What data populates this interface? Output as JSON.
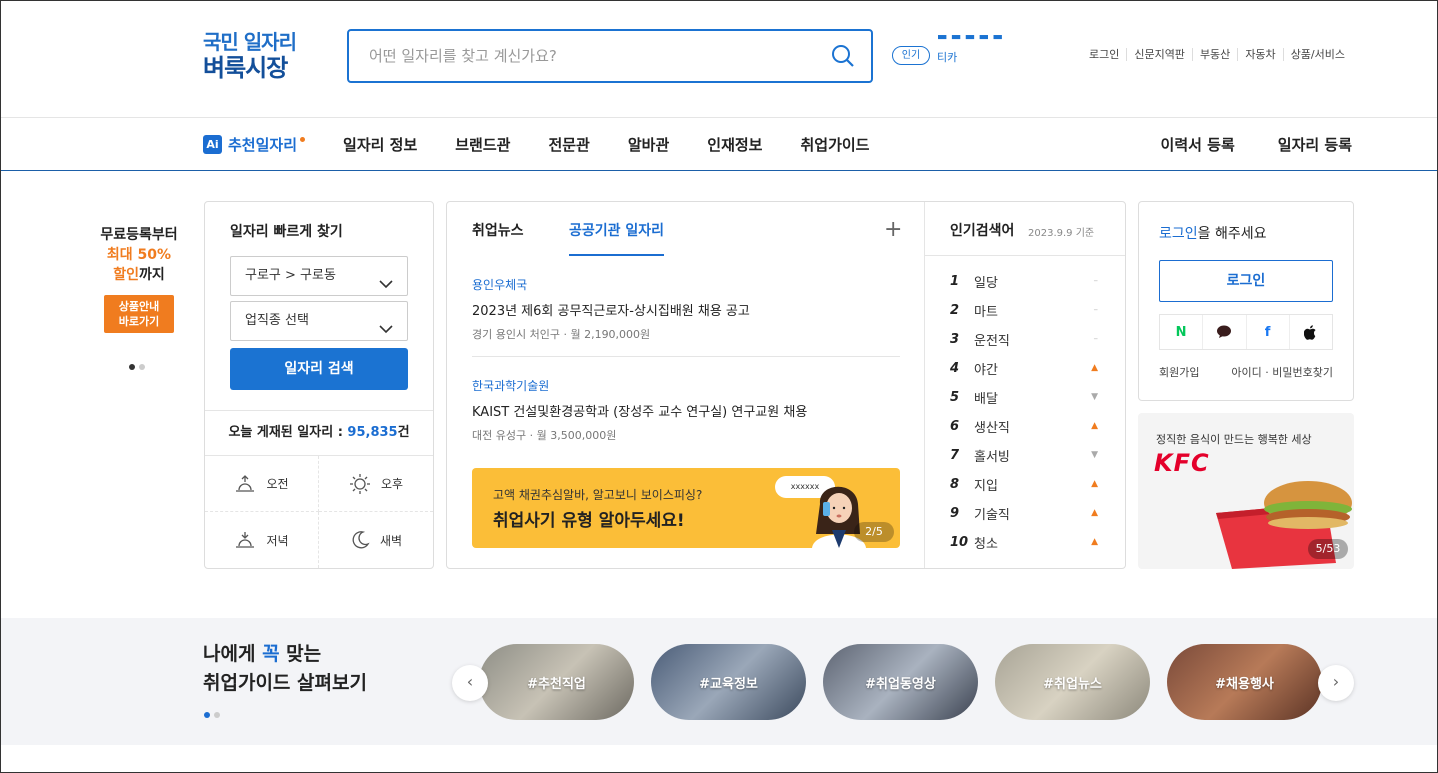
{
  "header": {
    "logo_line1": "국민 일자리",
    "logo_line2": "벼룩시장",
    "search_placeholder": "어떤 일자리를 찾고 계신가요?",
    "popular_badge": "인기",
    "popular_word": "티카",
    "util_links": [
      "로그인",
      "신문지역판",
      "부동산",
      "자동차",
      "상품/서비스"
    ]
  },
  "gnb": {
    "ai_label": "Ai",
    "ai_item": "추천일자리",
    "items": [
      "일자리 정보",
      "브랜드관",
      "전문관",
      "알바관",
      "인재정보",
      "취업가이드"
    ],
    "right": [
      "이력서 등록",
      "일자리 등록"
    ]
  },
  "promo": {
    "line1": "무료등록부터",
    "line2": "최대 50%",
    "line3a": "할인",
    "line3b": "까지",
    "btn": "상품안내\n바로가기"
  },
  "quick": {
    "title": "일자리 빠르게 찾기",
    "region": "구로구 > 구로동",
    "category": "업직종 선택",
    "search_btn": "일자리 검색",
    "today_label": "오늘 게재된 일자리 : ",
    "today_count": "95,835",
    "today_unit": "건",
    "times": [
      "오전",
      "오후",
      "저녁",
      "새벽"
    ]
  },
  "news": {
    "tabs": [
      "취업뉴스",
      "공공기관 일자리"
    ],
    "items": [
      {
        "org": "용인우체국",
        "title": "2023년 제6회 공무직근로자-상시집배원 채용 공고",
        "location": "경기 용인시 처인구",
        "pay": "월 2,190,000원"
      },
      {
        "org": "한국과학기술원",
        "title": "KAIST 건설및환경공학과 (장성주 교수 연구실) 연구교원 채용",
        "location": "대전 유성구",
        "pay": "월 3,500,000원"
      }
    ],
    "banner_line1": "고액 채권추심알바, 알고보니 보이스피싱?",
    "banner_line2": "취업사기 유형 알아두세요!",
    "banner_bubble": "xxxxxx",
    "banner_count": "2/5"
  },
  "ranking": {
    "title": "인기검색어",
    "date": "2023.9.9 기준",
    "items": [
      {
        "rank": "1",
        "word": "일당",
        "trend": "–",
        "dir": "same"
      },
      {
        "rank": "2",
        "word": "마트",
        "trend": "–",
        "dir": "same"
      },
      {
        "rank": "3",
        "word": "운전직",
        "trend": "–",
        "dir": "same"
      },
      {
        "rank": "4",
        "word": "야간",
        "trend": "▲",
        "dir": "up"
      },
      {
        "rank": "5",
        "word": "배달",
        "trend": "▼",
        "dir": "dn"
      },
      {
        "rank": "6",
        "word": "생산직",
        "trend": "▲",
        "dir": "up"
      },
      {
        "rank": "7",
        "word": "홀서빙",
        "trend": "▼",
        "dir": "dn"
      },
      {
        "rank": "8",
        "word": "지입",
        "trend": "▲",
        "dir": "up"
      },
      {
        "rank": "9",
        "word": "기술직",
        "trend": "▲",
        "dir": "up"
      },
      {
        "rank": "10",
        "word": "청소",
        "trend": "▲",
        "dir": "up"
      }
    ]
  },
  "login": {
    "prompt_link": "로그인",
    "prompt_rest": "을 해주세요",
    "button": "로그인",
    "sns": [
      "N",
      "naver-talk",
      "f",
      "apple"
    ],
    "join": "회원가입",
    "find": "아이디 · 비밀번호찾기"
  },
  "ad": {
    "text": "정직한 음식이 만드는 행복한 세상",
    "brand": "KFC",
    "count": "5/53"
  },
  "guide": {
    "title_pre": "나에게 ",
    "title_hl": "꼭",
    "title_post": " 맞는",
    "title_line2": "취업가이드 살펴보기",
    "pills": [
      "#추천직업",
      "#교육정보",
      "#취업동영상",
      "#취업뉴스",
      "#채용행사"
    ],
    "prev": "‹",
    "next": "›"
  },
  "colors": {
    "brand": "#1b73d2",
    "accent": "#f07c1f",
    "kfc": "#e4002b"
  }
}
